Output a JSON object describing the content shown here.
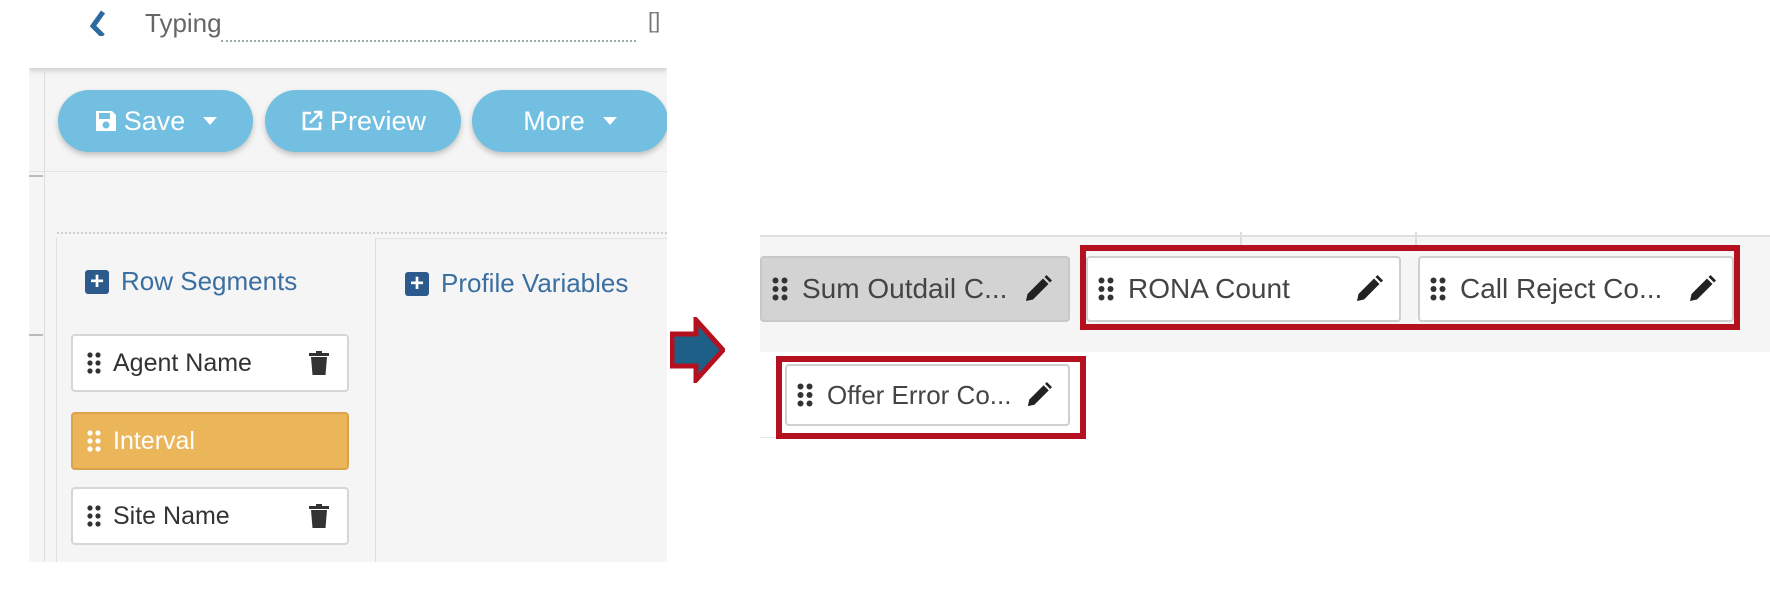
{
  "header": {
    "name_input_text": "Typing",
    "right_glyph": "[]"
  },
  "toolbar": {
    "save_label": "Save",
    "preview_label": "Preview",
    "more_label": "More"
  },
  "sections": {
    "row_segments": "Row Segments",
    "profile_variables": "Profile Variables"
  },
  "row_segments": [
    {
      "label": "Agent Name",
      "selected": false
    },
    {
      "label": "Interval",
      "selected": true
    },
    {
      "label": "Site Name",
      "selected": false
    }
  ],
  "fields": {
    "sum_outdail": "Sum Outdail C...",
    "rona_count": "RONA Count",
    "call_reject": "Call Reject Co...",
    "offer_error": "Offer Error Co..."
  },
  "colors": {
    "button_bg": "#72bfe1",
    "selected_segment": "#ebb55a",
    "highlight": "#b5101f",
    "arrow_fill": "#1d5f86",
    "arrow_outline": "#b5101f",
    "section_header": "#3b6fa0"
  },
  "icons": {
    "save": "floppy-disk-icon",
    "preview": "external-link-icon",
    "grip": "drag-handle-icon",
    "trash": "trash-icon",
    "pencil": "pencil-icon",
    "plus": "plus-square-icon",
    "arrow": "right-arrow-icon"
  }
}
